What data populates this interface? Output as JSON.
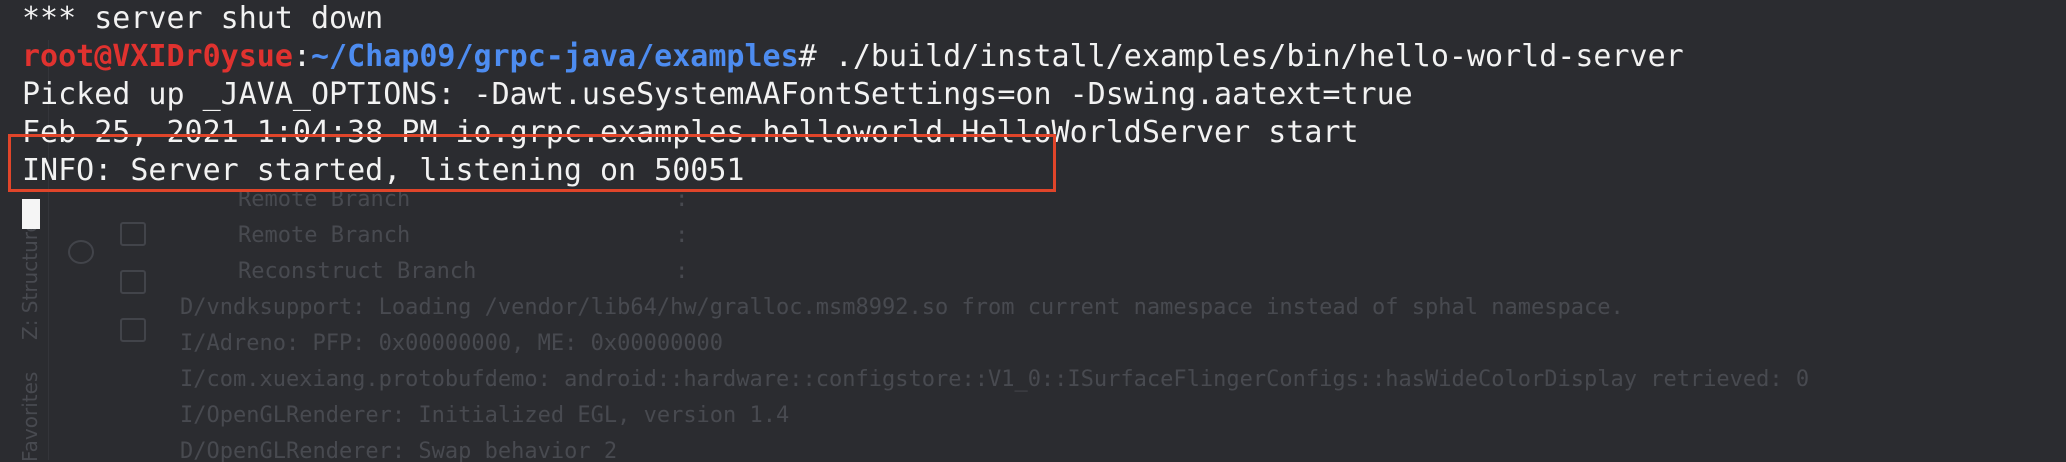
{
  "terminal": {
    "line1": "*** server shut down",
    "prompt_user": "root@VXIDr0ysue",
    "prompt_sep": ":",
    "prompt_path": "~/Chap09/grpc-java/examples",
    "prompt_cmd": "# ./build/install/examples/bin/hello-world-server",
    "line3": "Picked up _JAVA_OPTIONS: -Dawt.useSystemAAFontSettings=on -Dswing.aatext=true",
    "line4": "Feb 25, 2021 1:04:38 PM io.grpc.examples.helloworld.HelloWorldServer start",
    "line5": "INFO: Server started, listening on 50051"
  },
  "background_log": {
    "rows": [
      "Remote Branch                    :",
      "Remote Branch                    :",
      "Reconstruct Branch               :",
      "D/vndksupport: Loading /vendor/lib64/hw/gralloc.msm8992.so from current namespace instead of sphal namespace.",
      "I/Adreno: PFP: 0x00000000, ME: 0x00000000",
      "I/com.xuexiang.protobufdemo: android::hardware::configstore::V1_0::ISurfaceFlingerConfigs::hasWideColorDisplay retrieved: 0",
      "I/OpenGLRenderer: Initialized EGL, version 1.4",
      "D/OpenGLRenderer: Swap behavior 2"
    ],
    "side_labels": [
      "Z: Structure",
      "Favorites"
    ]
  },
  "colors": {
    "background": "#2b2c30",
    "prompt_user": "#e0322f",
    "prompt_path": "#4d8cf0",
    "text": "#f2f2f2",
    "highlight_border": "#e0452a"
  }
}
